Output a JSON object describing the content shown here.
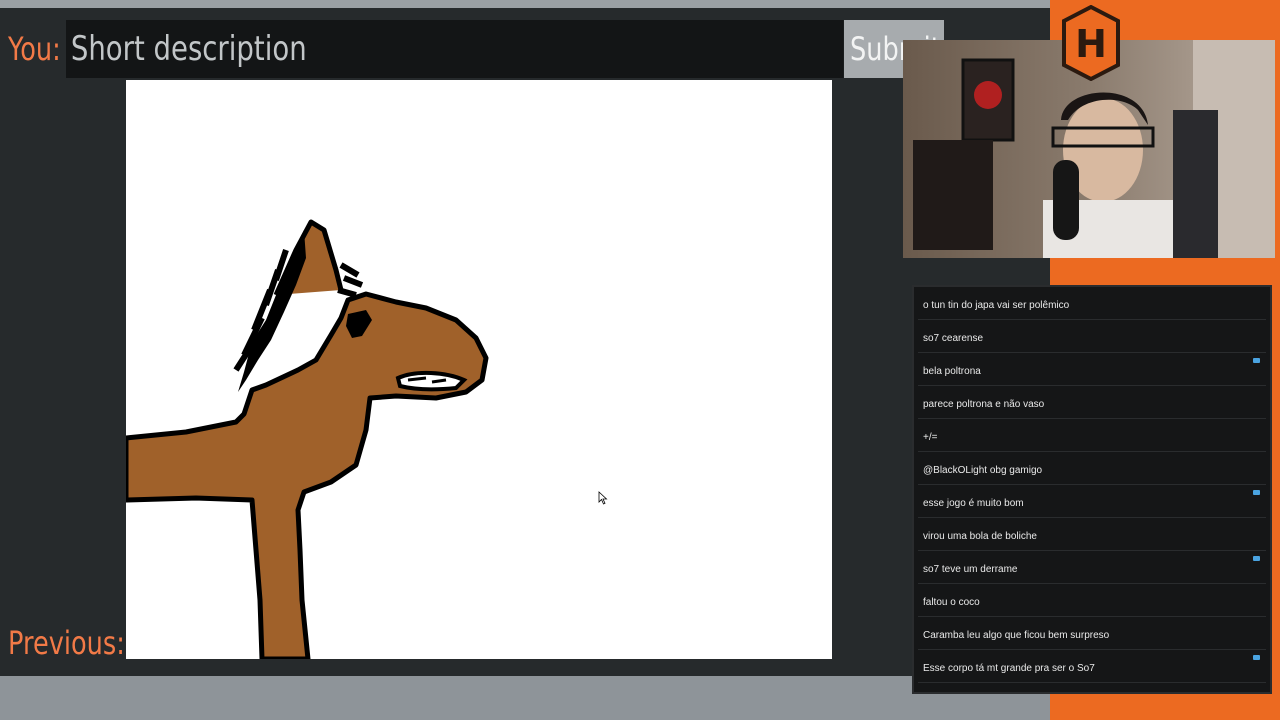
{
  "game": {
    "you_label": "You:",
    "description_placeholder": "Short description",
    "submit_label": "Submit",
    "previous_label": "Previous:"
  },
  "colors": {
    "accent": "#f27a47",
    "panel": "#262a2c",
    "horse_fill": "#a0612a",
    "stream_orange": "#ec6a21"
  },
  "stream": {
    "logo_letter": "H"
  },
  "chat": {
    "messages": [
      {
        "text": "o tun tin do japa vai ser polêmico"
      },
      {
        "text": "so7 cearense"
      },
      {
        "text": "bela poltrona"
      },
      {
        "text": "parece poltrona e não vaso"
      },
      {
        "text": "+/="
      },
      {
        "text": "@BlackOLight obg gamigo"
      },
      {
        "text": "esse jogo é muito bom"
      },
      {
        "text": "virou uma bola de boliche"
      },
      {
        "text": "so7 teve um derrame"
      },
      {
        "text": "faltou o coco"
      },
      {
        "text": "Caramba leu algo que ficou bem surpreso"
      },
      {
        "text": "Esse corpo tá mt grande pra ser o So7"
      }
    ]
  }
}
